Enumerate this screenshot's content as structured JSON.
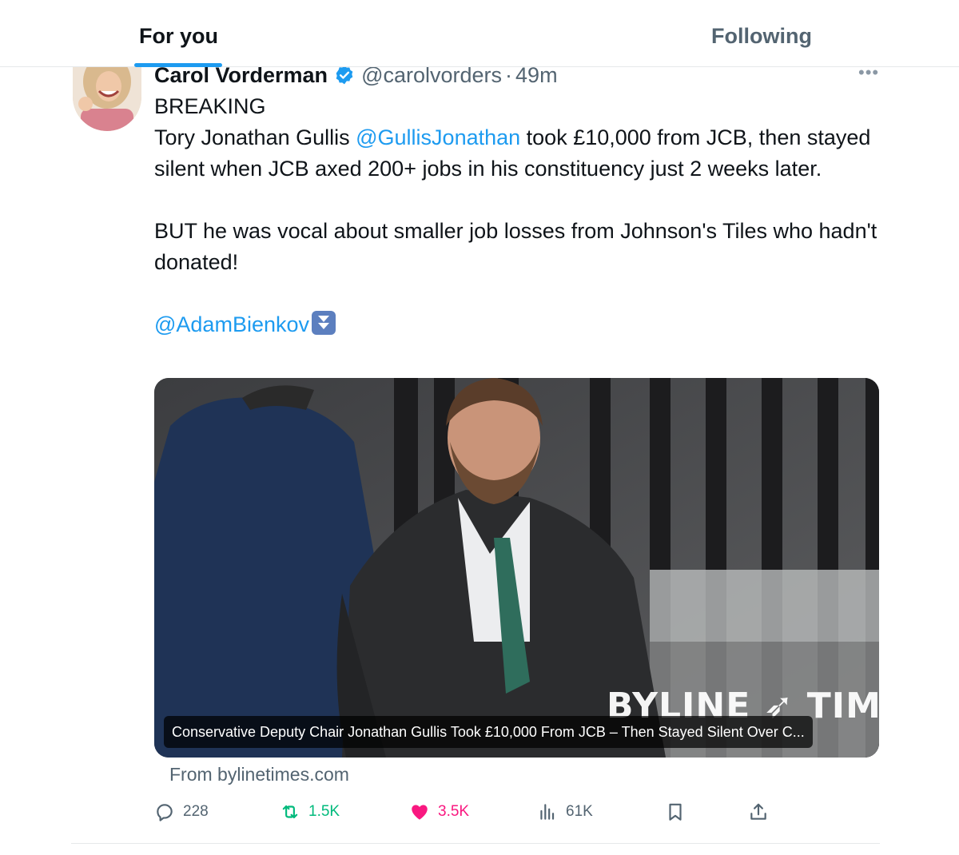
{
  "tabs": [
    {
      "label": "For you",
      "active": true
    },
    {
      "label": "Following",
      "active": false
    }
  ],
  "tweet": {
    "author_name": "Carol Vorderman",
    "handle": "@carolvorders",
    "separator": "·",
    "time": "49m",
    "more_label": "•••",
    "text": {
      "line1": "BREAKING",
      "para1_prefix": "Tory Jonathan Gullis ",
      "para1_mention": "@GullisJonathan",
      "para1_suffix": " took £10,000 from JCB, then stayed silent when JCB axed 200+ jobs in his constituency just 2 weeks later.",
      "para2": "BUT he was vocal about smaller job losses from Johnson's Tiles who hadn't donated!",
      "mention2": "@AdamBienkov"
    },
    "card": {
      "caption": "Conservative Deputy Chair Jonathan Gullis Took £10,000 From JCB – Then Stayed Silent Over C...",
      "watermark": "BYLINE ➶ TIMES",
      "source": "From bylinetimes.com"
    },
    "actions": {
      "replies": "228",
      "reposts": "1.5K",
      "likes": "3.5K",
      "views": "61K"
    }
  },
  "colors": {
    "accent": "#1d9bf0",
    "repost": "#00ba7c",
    "like": "#f91880",
    "muted": "#536471"
  },
  "icons": [
    "verified-badge-icon",
    "reply-icon",
    "repost-icon",
    "like-icon",
    "views-icon",
    "bookmark-icon",
    "share-icon",
    "more-icon"
  ]
}
